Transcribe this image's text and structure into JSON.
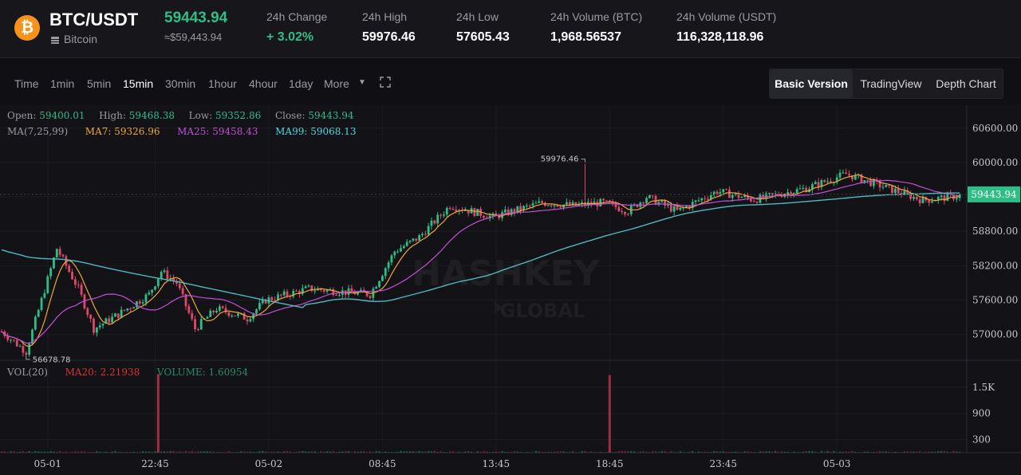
{
  "header": {
    "coin_symbol": "₿",
    "pair": "BTC/USDT",
    "coin_name": "Bitcoin",
    "last_price": "59443.94",
    "last_price_fiat": "≈$59,443.94",
    "stats": [
      {
        "label": "24h Change",
        "value": "+ 3.02%",
        "color": "green"
      },
      {
        "label": "24h High",
        "value": "59976.46"
      },
      {
        "label": "24h Low",
        "value": "57605.43"
      },
      {
        "label": "24h Volume (BTC)",
        "value": "1,968.56537"
      },
      {
        "label": "24h Volume (USDT)",
        "value": "116,328,118.96"
      }
    ]
  },
  "toolbar": {
    "intervals": [
      "Time",
      "1min",
      "5min",
      "15min",
      "30min",
      "1hour",
      "4hour",
      "1day",
      "More"
    ],
    "active_interval": "15min",
    "more_caret": "▼",
    "versions": [
      "Basic Version",
      "TradingView",
      "Depth Chart"
    ],
    "active_version": "Basic Version"
  },
  "legend": {
    "open_label": "Open:",
    "open": "59400.01",
    "high_label": "High:",
    "high": "59468.38",
    "low_label": "Low:",
    "low": "59352.86",
    "close_label": "Close:",
    "close": "59443.94",
    "ma_label": "MA(7,25,99)",
    "ma7": "MA7: 59326.96",
    "ma25": "MA25: 59458.43",
    "ma99": "MA99: 59068.13",
    "vol_label": "VOL(20)",
    "ma20": "MA20: 2.21938",
    "volume": "VOLUME: 1.60954"
  },
  "watermark": {
    "line1": "HASHKEY",
    "line2": "GLOBAL"
  },
  "colors": {
    "up": "#2ebd85",
    "down": "#e0486a",
    "ma7": "#f0a63a",
    "ma25": "#c34fd8",
    "ma99": "#52b7c0",
    "vol": "#9a3040",
    "price_tag_bg": "#2ebd85"
  },
  "chart_data": {
    "type": "candlestick",
    "price_axis": {
      "ticks": [
        60600,
        60000,
        59400,
        58800,
        58200,
        57600,
        57000
      ],
      "tick_labels": [
        "60600.00",
        "60000.00",
        "59400.00",
        "58800.00",
        "58200.00",
        "57600.00",
        "57000.00"
      ],
      "range": [
        56550,
        61000
      ]
    },
    "volume_axis": {
      "ticks": [
        1500,
        900,
        300
      ],
      "tick_labels": [
        "1.5K",
        "900",
        "300"
      ],
      "range": [
        0,
        1900
      ]
    },
    "time_labels": [
      "05-01",
      "22:45",
      "05-02",
      "08:45",
      "13:45",
      "18:45",
      "23:45",
      "05-03"
    ],
    "current_price": 59443.94,
    "current_price_label": "59443.94",
    "high_marker": {
      "label": "59976.46",
      "value": 59976.46,
      "candle_index": 190
    },
    "low_marker": {
      "label": "56678.78",
      "value": 56678.78,
      "candle_index": 8
    },
    "anchors": [
      [
        0,
        57050
      ],
      [
        8,
        56700
      ],
      [
        18,
        58500
      ],
      [
        25,
        57800
      ],
      [
        30,
        57100
      ],
      [
        38,
        57350
      ],
      [
        48,
        57700
      ],
      [
        52,
        58100
      ],
      [
        57,
        57900
      ],
      [
        63,
        57100
      ],
      [
        70,
        57450
      ],
      [
        80,
        57280
      ],
      [
        86,
        57600
      ],
      [
        100,
        57800
      ],
      [
        120,
        57700
      ],
      [
        128,
        58450
      ],
      [
        136,
        58700
      ],
      [
        146,
        59250
      ],
      [
        160,
        59050
      ],
      [
        176,
        59300
      ],
      [
        186,
        59250
      ],
      [
        196,
        59300
      ],
      [
        204,
        59150
      ],
      [
        210,
        59400
      ],
      [
        220,
        59150
      ],
      [
        233,
        59500
      ],
      [
        245,
        59350
      ],
      [
        262,
        59550
      ],
      [
        275,
        59800
      ],
      [
        286,
        59600
      ],
      [
        300,
        59340
      ],
      [
        312,
        59420
      ]
    ],
    "volume_spikes": [
      {
        "candle_index": 51,
        "volume": 1800
      },
      {
        "candle_index": 198,
        "volume": 1780
      }
    ]
  }
}
